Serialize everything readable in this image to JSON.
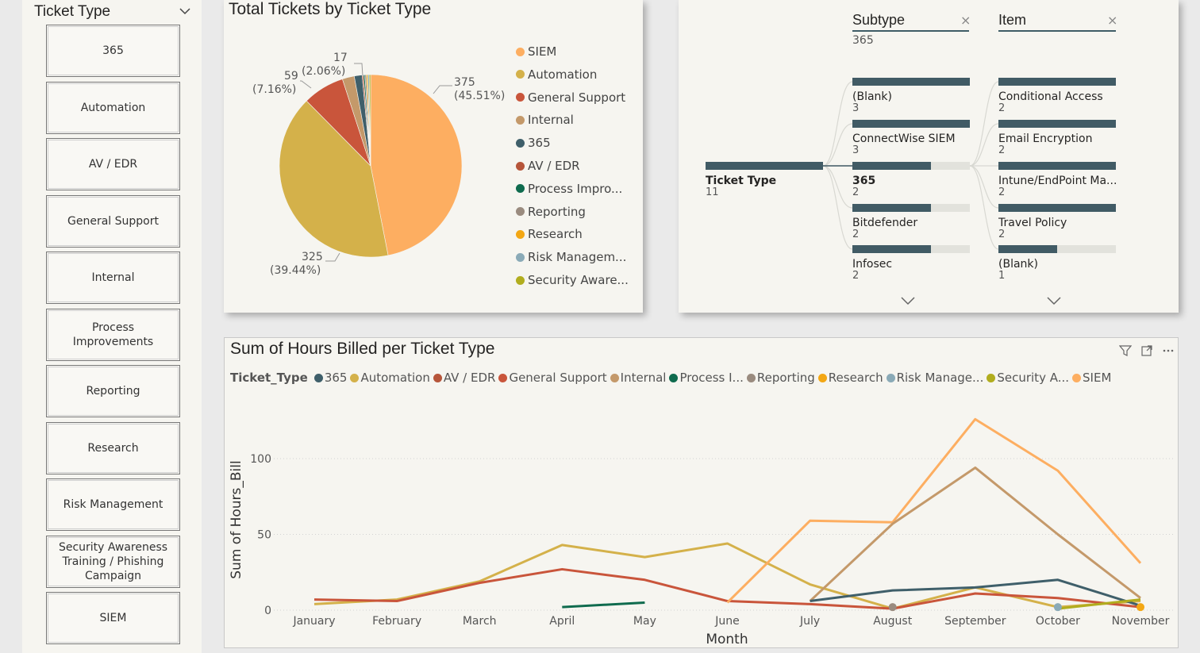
{
  "slicer": {
    "title": "Ticket Type",
    "items": [
      "365",
      "Automation",
      "AV / EDR",
      "General Support",
      "Internal",
      "Process Improvements",
      "Reporting",
      "Research",
      "Risk Management",
      "Security Awareness Training / Phishing Campaign",
      "SIEM"
    ]
  },
  "pie": {
    "title": "Total Tickets by Ticket Type",
    "labels": {
      "siem_value": "375",
      "siem_pct": "(45.51%)",
      "automation_value": "325",
      "automation_pct": "(39.44%)",
      "general_value": "59",
      "general_pct": "(7.16%)",
      "internal_value": "17",
      "internal_pct": "(2.06%)"
    },
    "legend": [
      {
        "name": "SIEM",
        "color": "#fdae61"
      },
      {
        "name": "Automation",
        "color": "#d4b14a"
      },
      {
        "name": "General Support",
        "color": "#c9553b"
      },
      {
        "name": "Internal",
        "color": "#c4996a"
      },
      {
        "name": "365",
        "color": "#3f5f6a"
      },
      {
        "name": "AV / EDR",
        "color": "#b6553a"
      },
      {
        "name": "Process Impro...",
        "color": "#0f6b4e"
      },
      {
        "name": "Reporting",
        "color": "#9a8b7f"
      },
      {
        "name": "Research",
        "color": "#f3a714"
      },
      {
        "name": "Risk Managem...",
        "color": "#8aaab7"
      },
      {
        "name": "Security Aware...",
        "color": "#b1ad1e"
      }
    ]
  },
  "decomposition": {
    "headers": {
      "subtype": "Subtype",
      "subtype_value": "365",
      "item": "Item"
    },
    "root": {
      "label": "Ticket Type",
      "value": "11"
    },
    "subtypes": [
      {
        "label": "(Blank)",
        "value": "3",
        "fill": 1.0,
        "bold": false
      },
      {
        "label": "ConnectWise SIEM",
        "value": "3",
        "fill": 1.0,
        "bold": false
      },
      {
        "label": "365",
        "value": "2",
        "fill": 0.667,
        "bold": true
      },
      {
        "label": "Bitdefender",
        "value": "2",
        "fill": 0.667,
        "bold": false
      },
      {
        "label": "Infosec",
        "value": "2",
        "fill": 0.667,
        "bold": false
      }
    ],
    "items": [
      {
        "label": "Conditional Access",
        "value": "2",
        "fill": 1.0
      },
      {
        "label": "Email Encryption",
        "value": "2",
        "fill": 1.0
      },
      {
        "label": "Intune/EndPoint Ma...",
        "value": "2",
        "fill": 1.0
      },
      {
        "label": "Travel Policy",
        "value": "2",
        "fill": 1.0
      },
      {
        "label": "(Blank)",
        "value": "1",
        "fill": 0.5
      }
    ]
  },
  "line": {
    "title": "Sum of Hours Billed per Ticket Type",
    "legend_title": "Ticket_Type",
    "legend": [
      {
        "name": "365",
        "color": "#3f5f6a"
      },
      {
        "name": "Automation",
        "color": "#d4b14a"
      },
      {
        "name": "AV / EDR",
        "color": "#b6553a"
      },
      {
        "name": "General Support",
        "color": "#c9553b"
      },
      {
        "name": "Internal",
        "color": "#c4996a"
      },
      {
        "name": "Process I...",
        "color": "#0f6b4e"
      },
      {
        "name": "Reporting",
        "color": "#9a8b7f"
      },
      {
        "name": "Research",
        "color": "#f3a714"
      },
      {
        "name": "Risk Manage...",
        "color": "#8aaab7"
      },
      {
        "name": "Security A...",
        "color": "#b1ad1e"
      },
      {
        "name": "SIEM",
        "color": "#fdae61"
      }
    ],
    "xlabel": "Month",
    "ylabel": "Sum of Hours_Bill"
  },
  "chart_data": [
    {
      "type": "pie",
      "title": "Total Tickets by Ticket Type",
      "slices": [
        {
          "name": "SIEM",
          "value": 375,
          "color": "#fdae61"
        },
        {
          "name": "Automation",
          "value": 325,
          "color": "#d4b14a"
        },
        {
          "name": "General Support",
          "value": 59,
          "color": "#c9553b"
        },
        {
          "name": "Internal",
          "value": 17,
          "color": "#c4996a"
        },
        {
          "name": "365",
          "value": 11,
          "color": "#3f5f6a"
        },
        {
          "name": "AV / EDR",
          "value": 2,
          "color": "#b6553a"
        },
        {
          "name": "Process Improvements",
          "value": 2,
          "color": "#0f6b4e"
        },
        {
          "name": "Reporting",
          "value": 2,
          "color": "#9a8b7f"
        },
        {
          "name": "Research",
          "value": 2,
          "color": "#f3a714"
        },
        {
          "name": "Risk Management",
          "value": 2,
          "color": "#8aaab7"
        },
        {
          "name": "Security Awareness",
          "value": 2,
          "color": "#b1ad1e"
        }
      ]
    },
    {
      "type": "line",
      "title": "Sum of Hours Billed per Ticket Type",
      "categories": [
        "January",
        "February",
        "March",
        "April",
        "May",
        "June",
        "July",
        "August",
        "September",
        "October",
        "November"
      ],
      "xlabel": "Month",
      "ylabel": "Sum of Hours_Bill",
      "ylim": [
        0,
        130
      ],
      "yticks": [
        0,
        50,
        100
      ],
      "series": [
        {
          "name": "Automation",
          "color": "#d4b14a",
          "values": [
            4,
            7,
            19,
            43,
            35,
            44,
            17,
            1,
            15,
            2,
            6
          ]
        },
        {
          "name": "General Support",
          "color": "#c9553b",
          "values": [
            7,
            6,
            18,
            27,
            20,
            6,
            4,
            1,
            11,
            8,
            2
          ]
        },
        {
          "name": "Process Improvements",
          "color": "#0f6b4e",
          "values": [
            null,
            null,
            null,
            2,
            5,
            null,
            null,
            null,
            null,
            null,
            null
          ]
        },
        {
          "name": "SIEM",
          "color": "#fdae61",
          "values": [
            null,
            null,
            null,
            null,
            null,
            5,
            59,
            58,
            126,
            92,
            31
          ]
        },
        {
          "name": "Internal",
          "color": "#c4996a",
          "values": [
            null,
            null,
            null,
            null,
            null,
            null,
            6,
            57,
            94,
            50,
            8
          ]
        },
        {
          "name": "365",
          "color": "#3f5f6a",
          "values": [
            null,
            null,
            null,
            null,
            null,
            null,
            6,
            13,
            15,
            20,
            3
          ]
        },
        {
          "name": "Reporting",
          "color": "#9a8b7f",
          "values": [
            null,
            null,
            null,
            null,
            null,
            null,
            null,
            2,
            null,
            null,
            null
          ]
        },
        {
          "name": "Security Awareness",
          "color": "#b1ad1e",
          "values": [
            null,
            null,
            null,
            null,
            null,
            null,
            null,
            null,
            null,
            1,
            7
          ]
        },
        {
          "name": "Risk Management",
          "color": "#8aaab7",
          "values": [
            null,
            null,
            null,
            null,
            null,
            null,
            null,
            null,
            null,
            2,
            null
          ]
        },
        {
          "name": "Research",
          "color": "#f3a714",
          "values": [
            null,
            null,
            null,
            null,
            null,
            null,
            null,
            null,
            null,
            null,
            2
          ]
        }
      ]
    }
  ]
}
